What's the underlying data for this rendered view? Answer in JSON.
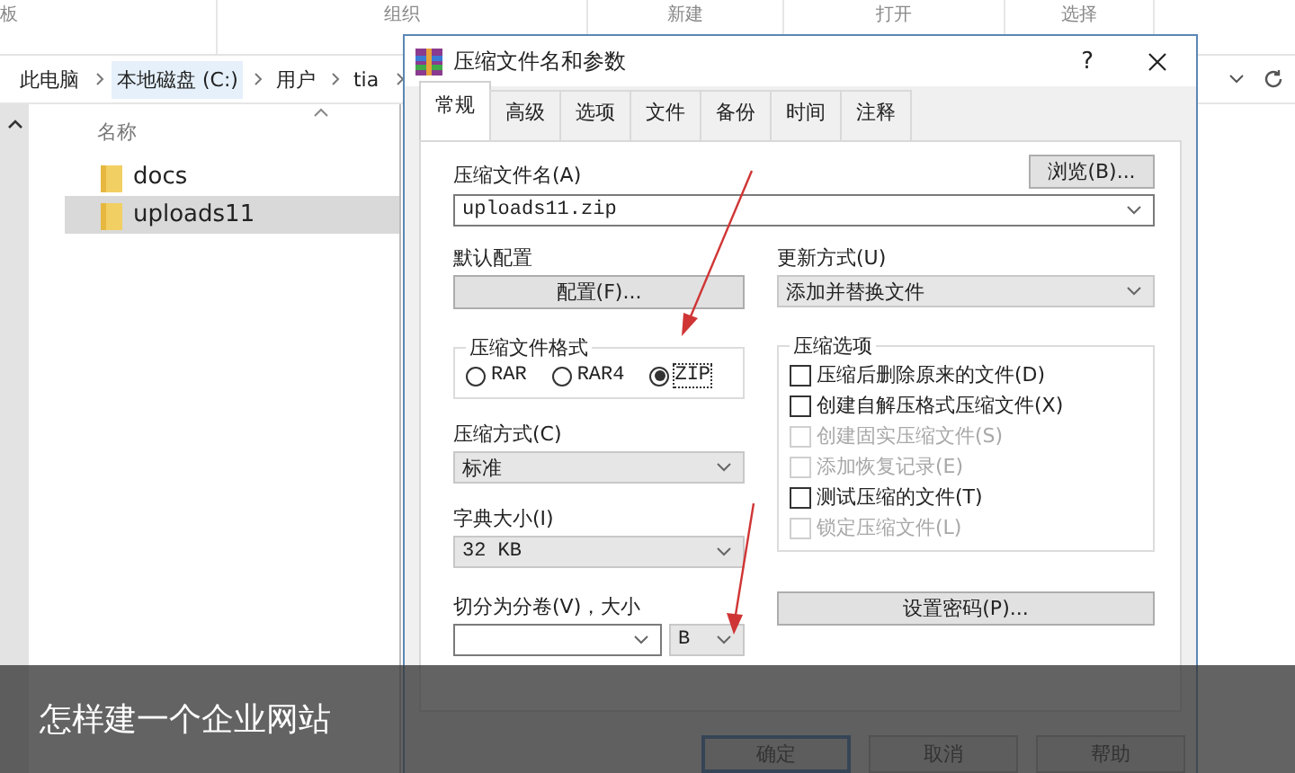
{
  "ribbon": {
    "groups": [
      "板",
      "组织",
      "新建",
      "打开",
      "选择"
    ]
  },
  "address_bar": {
    "crumbs": [
      {
        "label": "此电脑",
        "selected": false
      },
      {
        "label": "本地磁盘 (C:)",
        "selected": true
      },
      {
        "label": "用户",
        "selected": false
      },
      {
        "label": "tia",
        "selected": false
      }
    ]
  },
  "file_list": {
    "column": "名称",
    "items": [
      {
        "name": "docs",
        "selected": false
      },
      {
        "name": "uploads11",
        "selected": true
      }
    ]
  },
  "dialog": {
    "title": "压缩文件名和参数",
    "help": "?",
    "tabs": [
      {
        "label": "常规",
        "selected": true
      },
      {
        "label": "高级",
        "selected": false
      },
      {
        "label": "选项",
        "selected": false
      },
      {
        "label": "文件",
        "selected": false
      },
      {
        "label": "备份",
        "selected": false
      },
      {
        "label": "时间",
        "selected": false
      },
      {
        "label": "注释",
        "selected": false
      }
    ],
    "archive_name": {
      "label": "压缩文件名(A)",
      "value": "uploads11.zip"
    },
    "browse_button": "浏览(B)...",
    "default_profile": {
      "label": "默认配置",
      "button": "配置(F)..."
    },
    "update_mode": {
      "label": "更新方式(U)",
      "value": "添加并替换文件"
    },
    "archive_format": {
      "label": "压缩文件格式",
      "options": [
        {
          "label": "RAR",
          "selected": false
        },
        {
          "label": "RAR4",
          "selected": false
        },
        {
          "label": "ZIP",
          "selected": true
        }
      ]
    },
    "compression_method": {
      "label": "压缩方式(C)",
      "value": "标准"
    },
    "dictionary_size": {
      "label": "字典大小(I)",
      "value": "32 KB"
    },
    "split_volumes": {
      "label": "切分为分卷(V)，大小",
      "unit": "B"
    },
    "archiving_options": {
      "label": "压缩选项",
      "items": [
        {
          "label": "压缩后删除原来的文件(D)",
          "checked": false,
          "disabled": false
        },
        {
          "label": "创建自解压格式压缩文件(X)",
          "checked": false,
          "disabled": false
        },
        {
          "label": "创建固实压缩文件(S)",
          "checked": false,
          "disabled": true
        },
        {
          "label": "添加恢复记录(E)",
          "checked": false,
          "disabled": true
        },
        {
          "label": "测试压缩的文件(T)",
          "checked": false,
          "disabled": false
        },
        {
          "label": "锁定压缩文件(L)",
          "checked": false,
          "disabled": true
        }
      ]
    },
    "password_button": "设置密码(P)...",
    "buttons": [
      {
        "label": "确定",
        "default": true
      },
      {
        "label": "取消",
        "default": false
      },
      {
        "label": "帮助",
        "default": false
      }
    ]
  },
  "caption": "怎样建一个企业网站"
}
